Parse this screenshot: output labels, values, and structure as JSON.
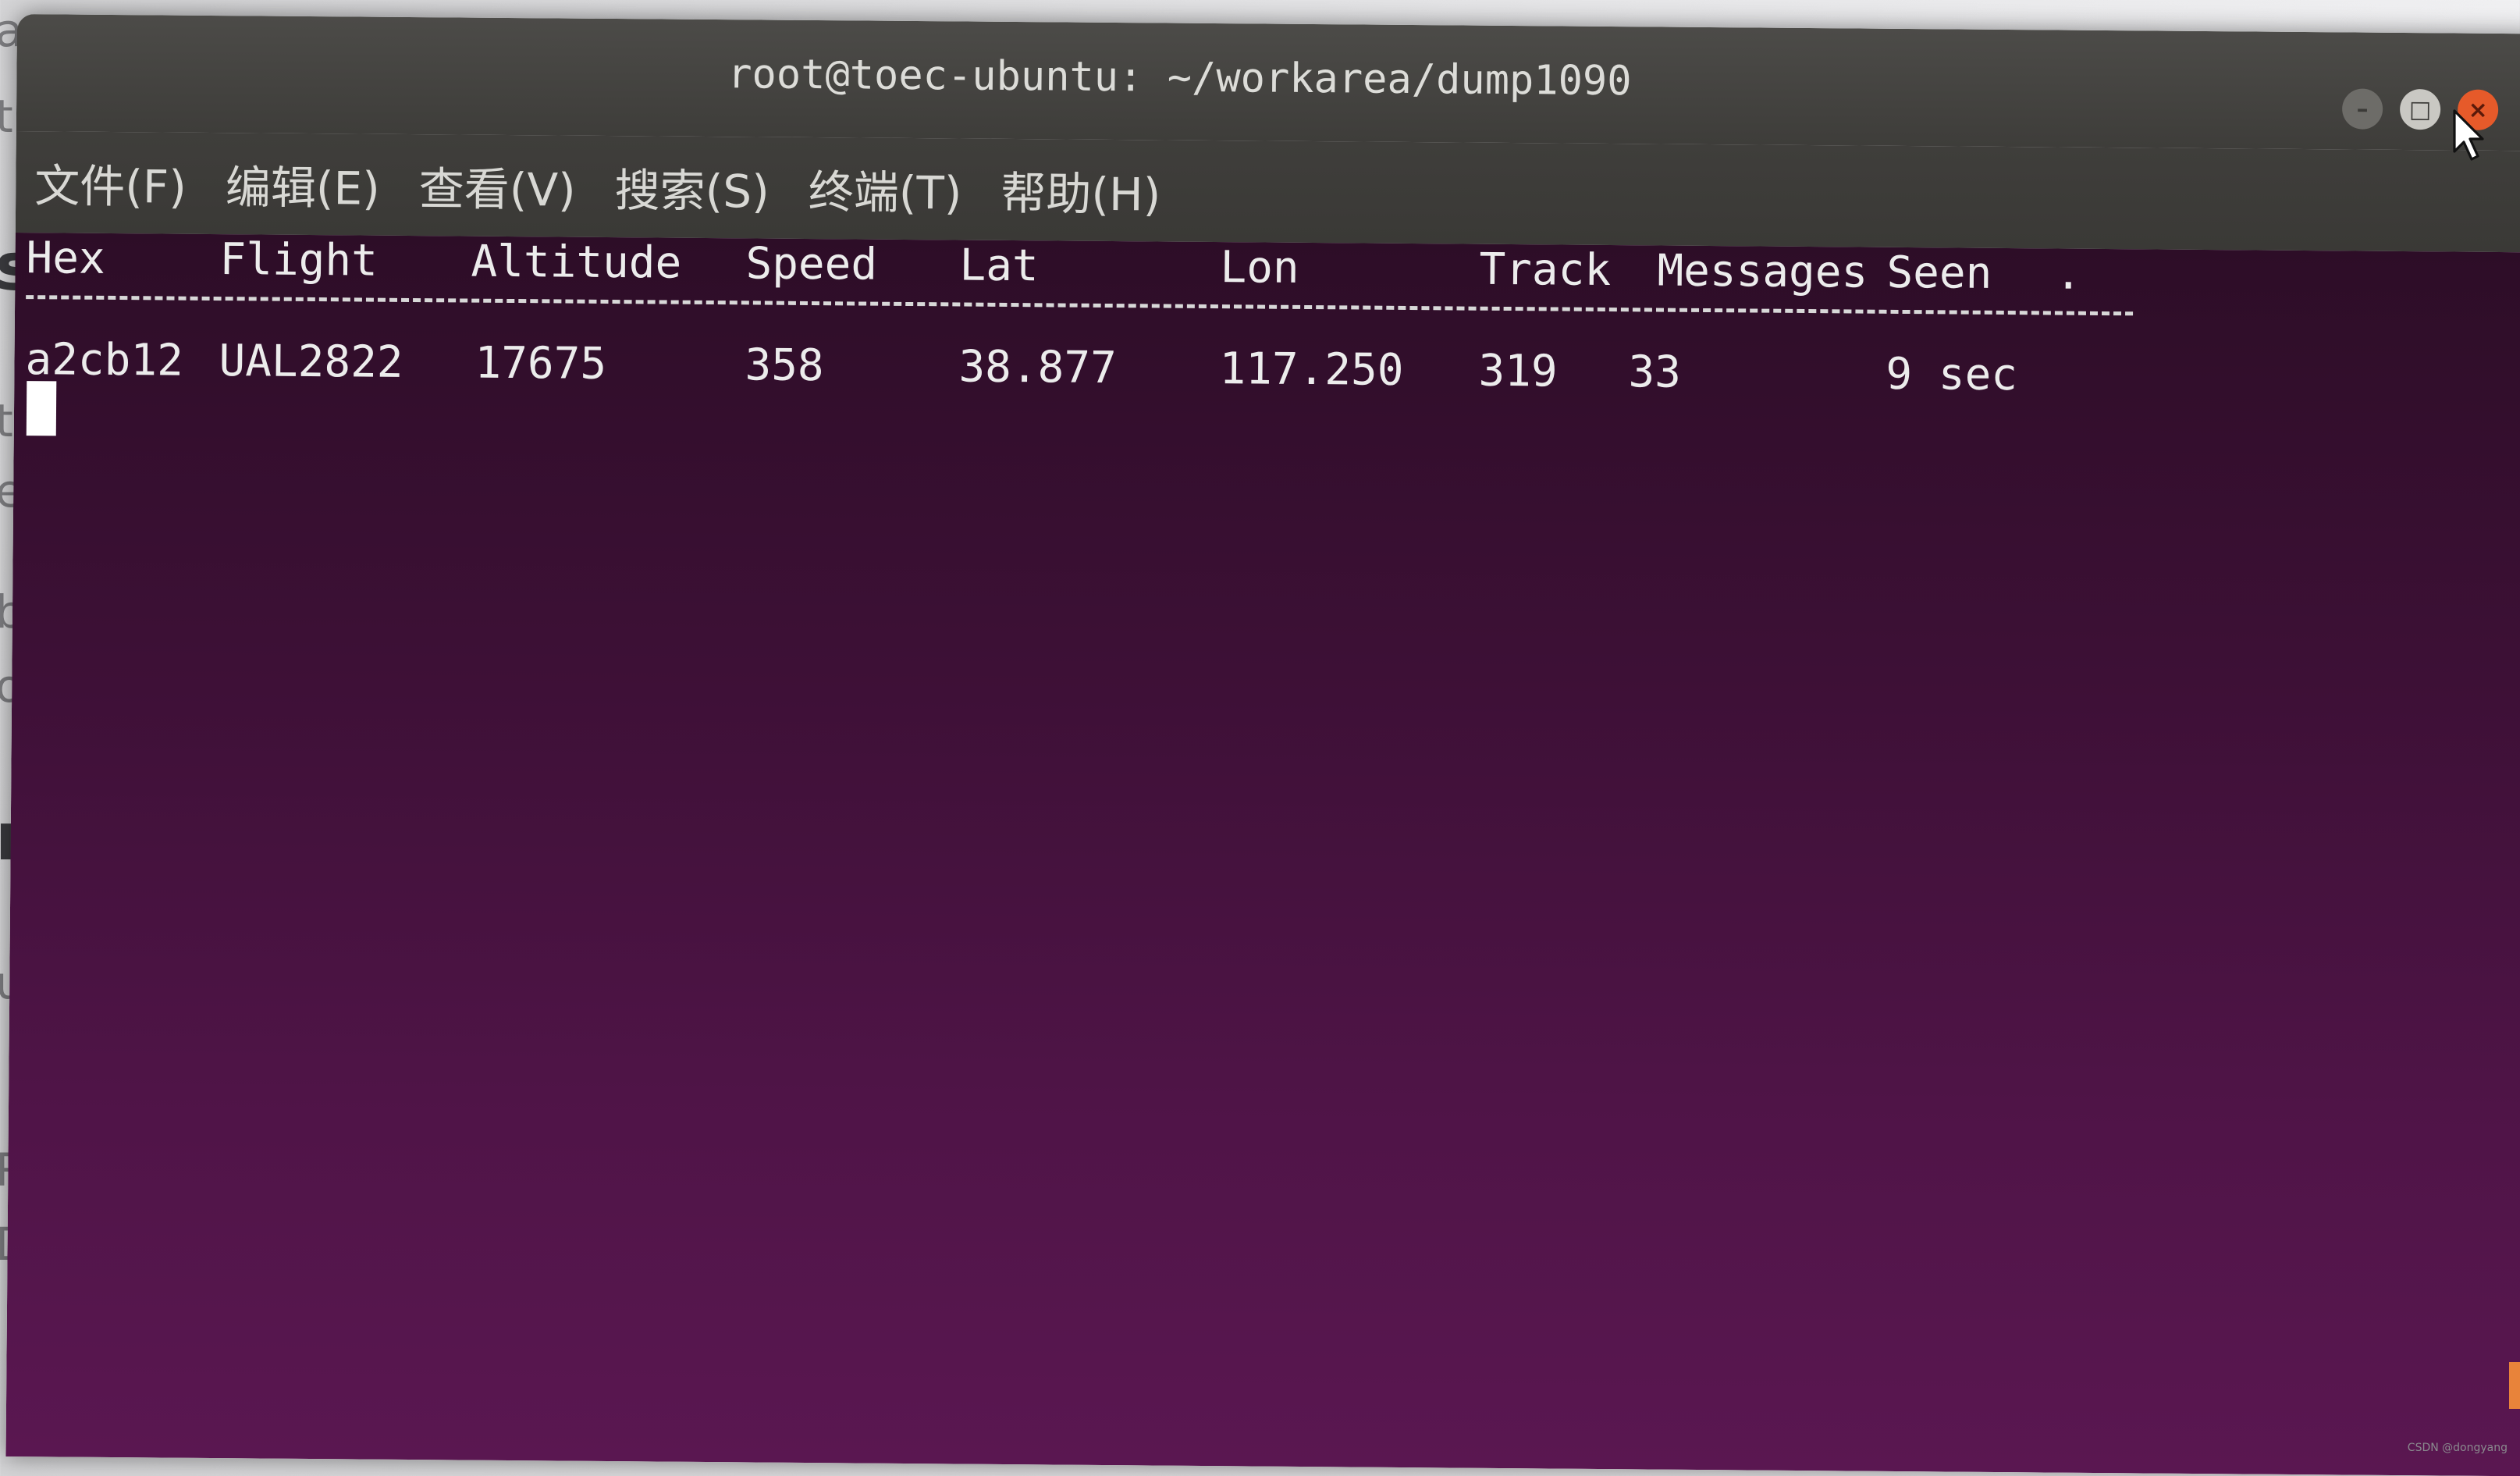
{
  "window": {
    "title": "root@toec-ubuntu: ~/workarea/dump1090",
    "controls": {
      "minimize": "–",
      "maximize": "□",
      "close": "×"
    }
  },
  "menu": [
    {
      "label": "文件(F)"
    },
    {
      "label": "编辑(E)"
    },
    {
      "label": "查看(V)"
    },
    {
      "label": "搜索(S)"
    },
    {
      "label": "终端(T)"
    },
    {
      "label": "帮助(H)"
    }
  ],
  "terminal": {
    "headers": [
      "Hex",
      "Flight",
      "Altitude",
      "Speed",
      "Lat",
      "Lon",
      "Track",
      "Messages",
      "Seen",
      "."
    ],
    "rows": [
      [
        "a2cb12",
        "UAL2822",
        "17675",
        "358",
        "38.877",
        "117.250",
        "319",
        "33",
        "9 sec",
        ""
      ]
    ]
  },
  "background_fragments": [
    "a",
    "t",
    "s",
    "t",
    "e",
    "b",
    "or",
    "m",
    "u",
    "R c",
    "Du"
  ],
  "watermark": "CSDN @dongyang"
}
